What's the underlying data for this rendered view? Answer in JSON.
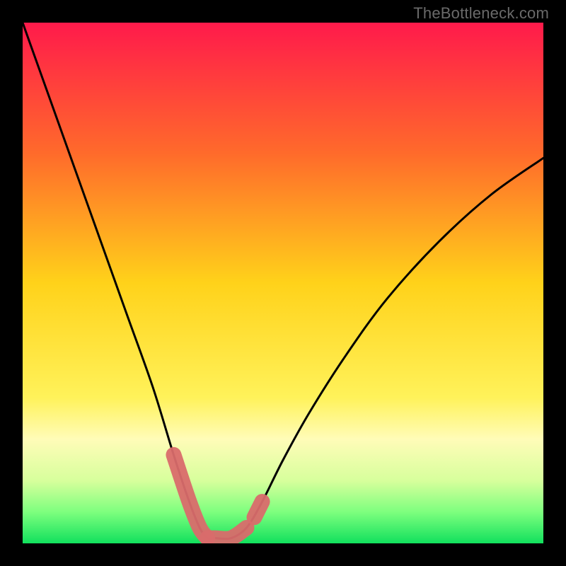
{
  "watermark": "TheBottleneck.com",
  "chart_data": {
    "type": "line",
    "title": "",
    "xlabel": "",
    "ylabel": "",
    "xlim": [
      0,
      100
    ],
    "ylim": [
      0,
      100
    ],
    "grid": false,
    "legend": false,
    "gradient_stops": [
      {
        "offset": 0,
        "color": "#ff1a4b"
      },
      {
        "offset": 0.25,
        "color": "#ff6a2b"
      },
      {
        "offset": 0.5,
        "color": "#ffd21a"
      },
      {
        "offset": 0.72,
        "color": "#fff25a"
      },
      {
        "offset": 0.8,
        "color": "#fffcb8"
      },
      {
        "offset": 0.88,
        "color": "#d7ff9c"
      },
      {
        "offset": 0.94,
        "color": "#7dff7e"
      },
      {
        "offset": 1.0,
        "color": "#11e05d"
      }
    ],
    "series": [
      {
        "name": "bottleneck-curve",
        "x": [
          0,
          5,
          10,
          15,
          20,
          25,
          29,
          32,
          34,
          35.5,
          37,
          40,
          43,
          46,
          50,
          55,
          62,
          70,
          80,
          90,
          100
        ],
        "y": [
          100,
          86,
          72,
          58,
          44,
          30,
          17,
          8,
          3,
          1,
          1,
          1,
          3,
          8,
          16,
          25,
          36,
          47,
          58,
          67,
          74
        ]
      }
    ],
    "highlight_segments": [
      {
        "name": "valley-left",
        "x": [
          29,
          32,
          34,
          35.5
        ],
        "y": [
          17,
          8,
          3,
          1
        ]
      },
      {
        "name": "valley-floor",
        "x": [
          35.5,
          37,
          40,
          43
        ],
        "y": [
          1,
          1,
          1,
          3
        ]
      },
      {
        "name": "valley-right",
        "x": [
          44.5,
          46
        ],
        "y": [
          5,
          8
        ]
      }
    ],
    "curve_color": "#000000",
    "highlight_color": "#d96b6b"
  }
}
